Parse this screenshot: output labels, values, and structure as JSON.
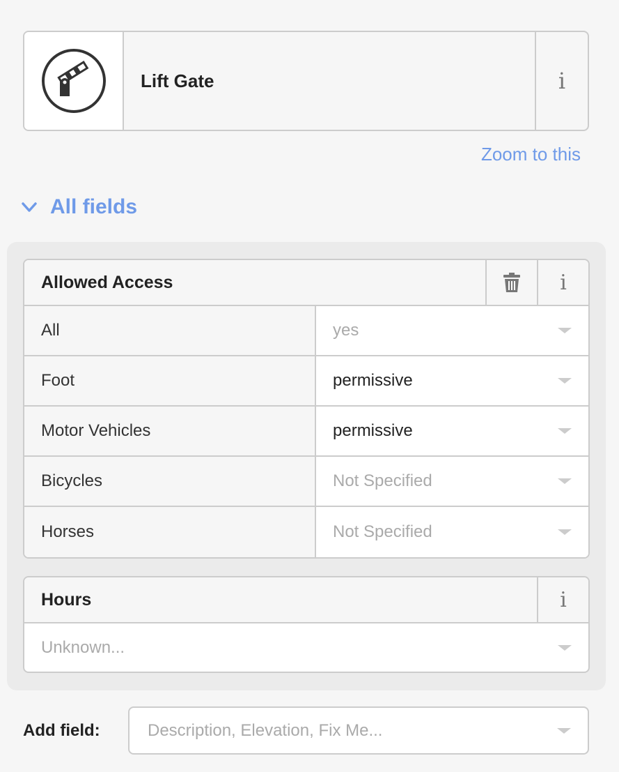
{
  "preset": {
    "icon": "lift-gate-icon",
    "name": "Lift Gate",
    "info_label": "i"
  },
  "zoom_link": "Zoom to this",
  "all_fields": {
    "label": "All fields",
    "icon": "chevron-down-icon"
  },
  "access": {
    "title": "Allowed Access",
    "delete_icon": "trash-icon",
    "info_label": "i",
    "rows": [
      {
        "label": "All",
        "value": "yes",
        "state": "placeholder"
      },
      {
        "label": "Foot",
        "value": "permissive",
        "state": "filled"
      },
      {
        "label": "Motor Vehicles",
        "value": "permissive",
        "state": "filled"
      },
      {
        "label": "Bicycles",
        "value": "Not Specified",
        "state": "placeholder"
      },
      {
        "label": "Horses",
        "value": "Not Specified",
        "state": "placeholder"
      }
    ]
  },
  "hours": {
    "title": "Hours",
    "info_label": "i",
    "placeholder": "Unknown..."
  },
  "add_field": {
    "label": "Add field:",
    "placeholder": "Description, Elevation, Fix Me..."
  },
  "colors": {
    "link": "#6f9ae8",
    "border": "#cccccc",
    "placeholder": "#aaaaaa"
  }
}
